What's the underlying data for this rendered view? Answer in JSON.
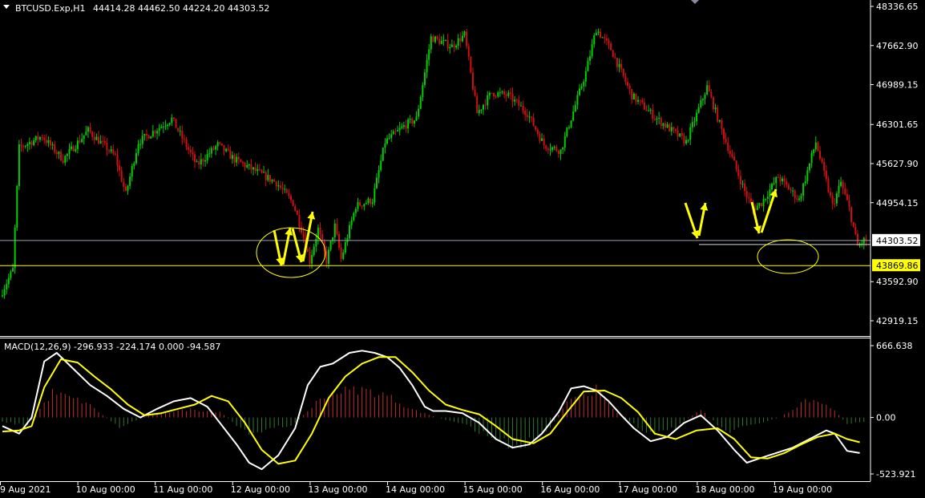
{
  "header": {
    "symbol": "BTCUSD.Exp,H1",
    "ohlc": "44414.28 44462.50 44224.20 44303.52"
  },
  "macd_header": "MACD(12,26,9) -296.933 -224.174 0.000 -94.587",
  "price_axis": {
    "ticks": [
      "48336.65",
      "47662.90",
      "46989.15",
      "46301.65",
      "45627.90",
      "44954.15",
      "43592.90",
      "42919.15"
    ],
    "current_price_label": "44303.52",
    "level_label": "43869.86"
  },
  "macd_axis": {
    "ticks": [
      "666.638",
      "0.00",
      "-523.921"
    ]
  },
  "time_axis": {
    "ticks": [
      "9 Aug 2021",
      "10 Aug 00:00",
      "11 Aug 00:00",
      "12 Aug 00:00",
      "13 Aug 00:00",
      "14 Aug 00:00",
      "15 Aug 00:00",
      "16 Aug 00:00",
      "17 Aug 00:00",
      "18 Aug 00:00",
      "19 Aug 00:00"
    ]
  },
  "colors": {
    "background": "#000000",
    "bull_candle": "#00d000",
    "bear_candle": "#d01010",
    "macd_line": "#ffffff",
    "signal_line": "#ffff00",
    "hist_pos": "#c03030",
    "hist_neg": "#2f7a2f",
    "level_line": "#ffff00",
    "price_line": "#9aa0b0",
    "annotation": "#ffff00"
  },
  "chart_data": [
    {
      "type": "candlestick",
      "title": "BTCUSD.Exp,H1",
      "ylim": [
        42800,
        48400
      ],
      "last_close": 44303.52,
      "horizontal_level": 43869.86,
      "anchors": [
        [
          0,
          43350
        ],
        [
          6,
          43800
        ],
        [
          9,
          45900
        ],
        [
          20,
          46100
        ],
        [
          30,
          45700
        ],
        [
          42,
          46200
        ],
        [
          55,
          45750
        ],
        [
          60,
          45100
        ],
        [
          66,
          46000
        ],
        [
          82,
          46400
        ],
        [
          94,
          45600
        ],
        [
          104,
          45950
        ],
        [
          112,
          45700
        ],
        [
          132,
          45300
        ],
        [
          140,
          44950
        ],
        [
          144,
          44500
        ],
        [
          148,
          43950
        ],
        [
          152,
          44500
        ],
        [
          156,
          43950
        ],
        [
          160,
          44550
        ],
        [
          163,
          43980
        ],
        [
          170,
          44900
        ],
        [
          178,
          45000
        ],
        [
          184,
          46000
        ],
        [
          194,
          46300
        ],
        [
          199,
          46400
        ],
        [
          206,
          47800
        ],
        [
          216,
          47650
        ],
        [
          222,
          47850
        ],
        [
          228,
          46500
        ],
        [
          235,
          46850
        ],
        [
          243,
          46800
        ],
        [
          252,
          46500
        ],
        [
          260,
          45950
        ],
        [
          268,
          45850
        ],
        [
          280,
          47200
        ],
        [
          285,
          47950
        ],
        [
          292,
          47600
        ],
        [
          302,
          46800
        ],
        [
          314,
          46400
        ],
        [
          328,
          46000
        ],
        [
          338,
          46950
        ],
        [
          346,
          46100
        ],
        [
          356,
          45150
        ],
        [
          360,
          44850
        ],
        [
          364,
          44950
        ],
        [
          372,
          45400
        ],
        [
          382,
          45000
        ],
        [
          390,
          46000
        ],
        [
          398,
          44900
        ],
        [
          402,
          45300
        ],
        [
          406,
          44850
        ],
        [
          410,
          44200
        ],
        [
          413,
          44303.52
        ]
      ]
    },
    {
      "type": "line",
      "title": "MACD(12,26,9)",
      "ylim": [
        -523.921,
        666.638
      ],
      "series": [
        {
          "name": "MACD",
          "points": [
            [
              0,
              -80
            ],
            [
              8,
              -150
            ],
            [
              14,
              0
            ],
            [
              20,
              520
            ],
            [
              26,
              600
            ],
            [
              34,
              450
            ],
            [
              42,
              300
            ],
            [
              50,
              200
            ],
            [
              58,
              80
            ],
            [
              66,
              0
            ],
            [
              74,
              80
            ],
            [
              82,
              150
            ],
            [
              90,
              180
            ],
            [
              98,
              100
            ],
            [
              104,
              -50
            ],
            [
              112,
              -250
            ],
            [
              118,
              -420
            ],
            [
              124,
              -480
            ],
            [
              132,
              -350
            ],
            [
              140,
              -100
            ],
            [
              146,
              300
            ],
            [
              152,
              470
            ],
            [
              158,
              500
            ],
            [
              166,
              600
            ],
            [
              172,
              620
            ],
            [
              178,
              600
            ],
            [
              184,
              560
            ],
            [
              190,
              460
            ],
            [
              196,
              300
            ],
            [
              202,
              100
            ],
            [
              206,
              60
            ],
            [
              212,
              60
            ],
            [
              220,
              40
            ],
            [
              228,
              -50
            ],
            [
              236,
              -200
            ],
            [
              244,
              -280
            ],
            [
              252,
              -250
            ],
            [
              258,
              -150
            ],
            [
              266,
              50
            ],
            [
              272,
              270
            ],
            [
              278,
              290
            ],
            [
              284,
              250
            ],
            [
              290,
              150
            ],
            [
              296,
              20
            ],
            [
              302,
              -100
            ],
            [
              310,
              -220
            ],
            [
              318,
              -180
            ],
            [
              326,
              -50
            ],
            [
              334,
              20
            ],
            [
              342,
              -120
            ],
            [
              350,
              -300
            ],
            [
              356,
              -420
            ],
            [
              362,
              -380
            ],
            [
              370,
              -330
            ],
            [
              378,
              -280
            ],
            [
              386,
              -200
            ],
            [
              394,
              -120
            ],
            [
              398,
              -150
            ],
            [
              404,
              -310
            ],
            [
              410,
              -330
            ]
          ]
        },
        {
          "name": "Signal",
          "points": [
            [
              0,
              -130
            ],
            [
              8,
              -120
            ],
            [
              14,
              -80
            ],
            [
              20,
              280
            ],
            [
              28,
              540
            ],
            [
              36,
              510
            ],
            [
              44,
              380
            ],
            [
              52,
              260
            ],
            [
              60,
              120
            ],
            [
              68,
              20
            ],
            [
              76,
              40
            ],
            [
              84,
              80
            ],
            [
              92,
              120
            ],
            [
              100,
              200
            ],
            [
              108,
              150
            ],
            [
              116,
              -50
            ],
            [
              124,
              -300
            ],
            [
              132,
              -430
            ],
            [
              140,
              -400
            ],
            [
              148,
              -150
            ],
            [
              156,
              180
            ],
            [
              164,
              380
            ],
            [
              172,
              500
            ],
            [
              180,
              560
            ],
            [
              188,
              560
            ],
            [
              196,
              420
            ],
            [
              204,
              250
            ],
            [
              212,
              120
            ],
            [
              220,
              70
            ],
            [
              228,
              30
            ],
            [
              236,
              -80
            ],
            [
              244,
              -200
            ],
            [
              254,
              -240
            ],
            [
              262,
              -150
            ],
            [
              270,
              50
            ],
            [
              278,
              240
            ],
            [
              288,
              250
            ],
            [
              296,
              180
            ],
            [
              304,
              50
            ],
            [
              312,
              -150
            ],
            [
              322,
              -200
            ],
            [
              332,
              -120
            ],
            [
              342,
              -100
            ],
            [
              350,
              -200
            ],
            [
              358,
              -370
            ],
            [
              366,
              -380
            ],
            [
              374,
              -330
            ],
            [
              382,
              -250
            ],
            [
              390,
              -180
            ],
            [
              398,
              -150
            ],
            [
              404,
              -200
            ],
            [
              410,
              -230
            ]
          ]
        }
      ],
      "histogram_values": [
        [
          0,
          -40
        ],
        [
          12,
          -80
        ],
        [
          24,
          250
        ],
        [
          40,
          150
        ],
        [
          56,
          -100
        ],
        [
          70,
          30
        ],
        [
          90,
          80
        ],
        [
          104,
          60
        ],
        [
          116,
          -150
        ],
        [
          128,
          -120
        ],
        [
          140,
          -60
        ],
        [
          150,
          150
        ],
        [
          160,
          260
        ],
        [
          172,
          280
        ],
        [
          184,
          220
        ],
        [
          196,
          80
        ],
        [
          208,
          0
        ],
        [
          222,
          -80
        ],
        [
          234,
          -200
        ],
        [
          246,
          -300
        ],
        [
          260,
          -150
        ],
        [
          272,
          200
        ],
        [
          284,
          280
        ],
        [
          296,
          0
        ],
        [
          310,
          -160
        ],
        [
          322,
          -100
        ],
        [
          334,
          80
        ],
        [
          346,
          -150
        ],
        [
          358,
          -80
        ],
        [
          372,
          0
        ],
        [
          384,
          180
        ],
        [
          394,
          150
        ],
        [
          404,
          -60
        ],
        [
          412,
          -50
        ]
      ]
    }
  ]
}
